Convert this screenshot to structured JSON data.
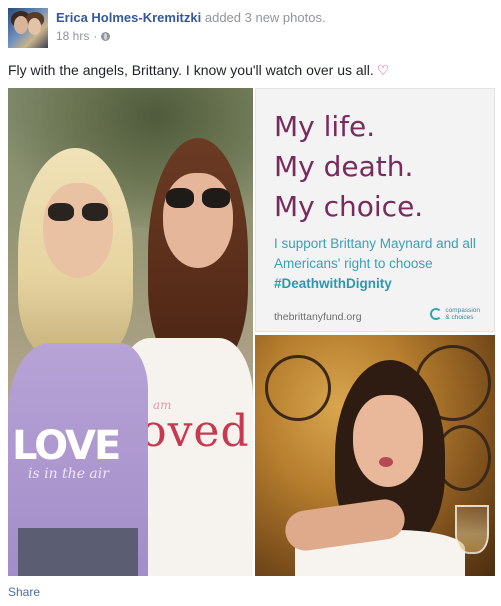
{
  "post": {
    "author": "Erica Holmes-Kremitzki",
    "action": "added 3 new photos.",
    "time": "18 hrs",
    "separator": "·",
    "message": "Fly with the angels, Brittany. I know you'll watch over us all.",
    "heart": "♡",
    "privacy_icon": "globe-icon"
  },
  "photos": {
    "main": {
      "shirt_left_text": "LOVE",
      "shirt_left_sub": "is in the air",
      "shirt_right_text": "loved",
      "shirt_right_sub": "am"
    },
    "quote": {
      "line1": "My life.",
      "line2": "My death.",
      "line3": "My choice.",
      "support": "I support Brittany Maynard and all Americans' right to choose",
      "hashtag": "#DeathwithDignity",
      "url": "thebrittanyfund.org",
      "logo_line1": "compassion",
      "logo_line2": "& choices"
    }
  },
  "actions": {
    "share": "Share"
  },
  "colors": {
    "link": "#365899",
    "quote_purple": "#7a2b5e",
    "quote_teal": "#3aa1b3"
  }
}
